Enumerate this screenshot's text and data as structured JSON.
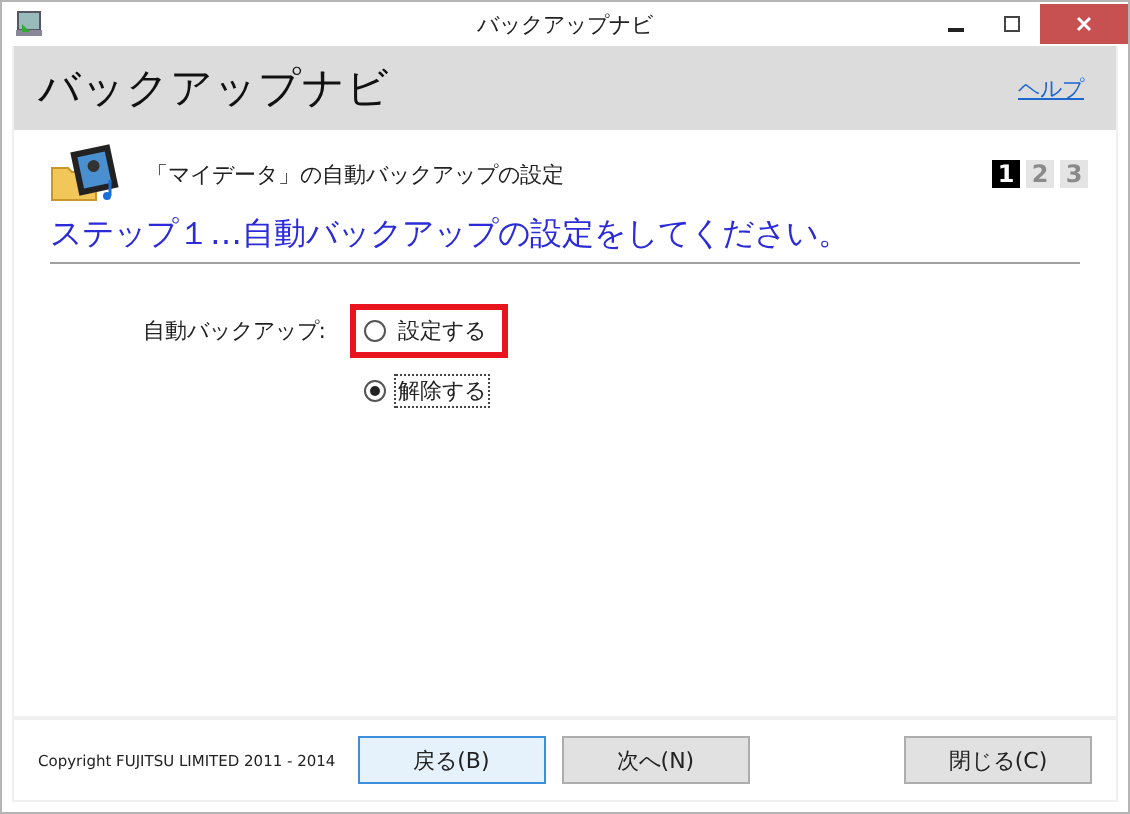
{
  "window": {
    "title": "バックアップナビ"
  },
  "header": {
    "title": "バックアップナビ",
    "help_link": "ヘルプ"
  },
  "section": {
    "title": "「マイデータ」の自動バックアップの設定"
  },
  "steps": [
    {
      "label": "1",
      "selected": true
    },
    {
      "label": "2",
      "selected": false
    },
    {
      "label": "3",
      "selected": false
    }
  ],
  "step_heading": "ステップ１…自動バックアップの設定をしてください。",
  "setting": {
    "label": "自動バックアップ:",
    "options": [
      {
        "label": "設定する",
        "selected": false,
        "highlighted": true,
        "focused": false
      },
      {
        "label": "解除する",
        "selected": true,
        "highlighted": false,
        "focused": true
      }
    ]
  },
  "footer": {
    "copyright": "Copyright FUJITSU LIMITED 2011 - 2014",
    "buttons": [
      {
        "label": "戻る(B)",
        "kind": "default"
      },
      {
        "label": "次へ(N)",
        "kind": "normal"
      },
      {
        "label": "閉じる(C)",
        "kind": "close"
      }
    ]
  }
}
